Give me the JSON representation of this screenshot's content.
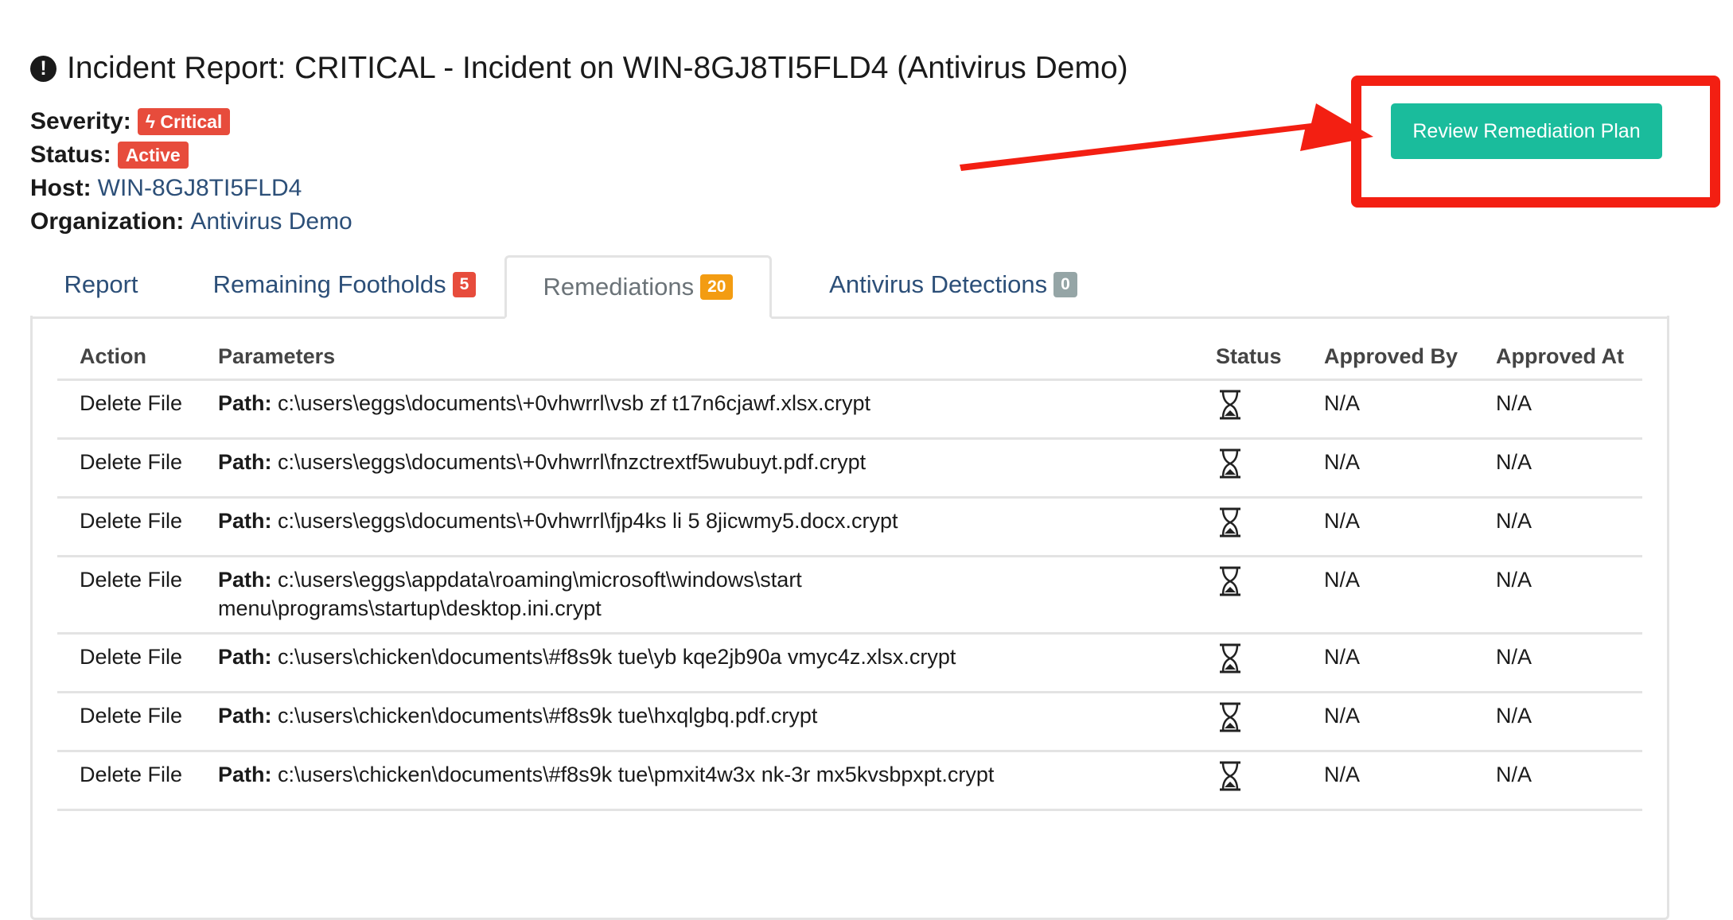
{
  "header": {
    "title": "Incident Report: CRITICAL - Incident on WIN-8GJ8TI5FLD4 (Antivirus Demo)",
    "icon": "exclamation-circle-icon"
  },
  "meta": {
    "severity_label": "Severity:",
    "severity_value": "Critical",
    "status_label": "Status:",
    "status_value": "Active",
    "host_label": "Host:",
    "host_value": "WIN-8GJ8TI5FLD4",
    "org_label": "Organization:",
    "org_value": "Antivirus Demo"
  },
  "actions": {
    "review_button": "Review Remediation Plan"
  },
  "tabs": [
    {
      "label": "Report",
      "count": null
    },
    {
      "label": "Remaining Footholds",
      "count": "5"
    },
    {
      "label": "Remediations",
      "count": "20"
    },
    {
      "label": "Antivirus Detections",
      "count": "0"
    }
  ],
  "table": {
    "headers": [
      "Action",
      "Parameters",
      "Status",
      "Approved By",
      "Approved At"
    ],
    "path_label": "Path:",
    "rows": [
      {
        "action": "Delete File",
        "path": "c:\\users\\eggs\\documents\\+0vhwrrl\\vsb zf t17n6cjawf.xlsx.crypt",
        "approved_by": "N/A",
        "approved_at": "N/A"
      },
      {
        "action": "Delete File",
        "path": "c:\\users\\eggs\\documents\\+0vhwrrl\\fnzctrextf5wubuyt.pdf.crypt",
        "approved_by": "N/A",
        "approved_at": "N/A"
      },
      {
        "action": "Delete File",
        "path": "c:\\users\\eggs\\documents\\+0vhwrrl\\fjp4ks li 5 8jicwmy5.docx.crypt",
        "approved_by": "N/A",
        "approved_at": "N/A"
      },
      {
        "action": "Delete File",
        "path": "c:\\users\\eggs\\appdata\\roaming\\microsoft\\windows\\start menu\\programs\\startup\\desktop.ini.crypt",
        "approved_by": "N/A",
        "approved_at": "N/A"
      },
      {
        "action": "Delete File",
        "path": "c:\\users\\chicken\\documents\\#f8s9k tue\\yb kqe2jb90a vmyc4z.xlsx.crypt",
        "approved_by": "N/A",
        "approved_at": "N/A"
      },
      {
        "action": "Delete File",
        "path": "c:\\users\\chicken\\documents\\#f8s9k tue\\hxqlgbq.pdf.crypt",
        "approved_by": "N/A",
        "approved_at": "N/A"
      },
      {
        "action": "Delete File",
        "path": "c:\\users\\chicken\\documents\\#f8s9k tue\\pmxit4w3x nk-3r mx5kvsbpxpt.crypt",
        "approved_by": "N/A",
        "approved_at": "N/A"
      }
    ]
  },
  "colors": {
    "critical": "#e74c3c",
    "teal": "#1abc9c",
    "callout": "#f31f12",
    "link": "#2c4f78",
    "badge_orange": "#f39c12",
    "badge_gray": "#95a5a6"
  }
}
